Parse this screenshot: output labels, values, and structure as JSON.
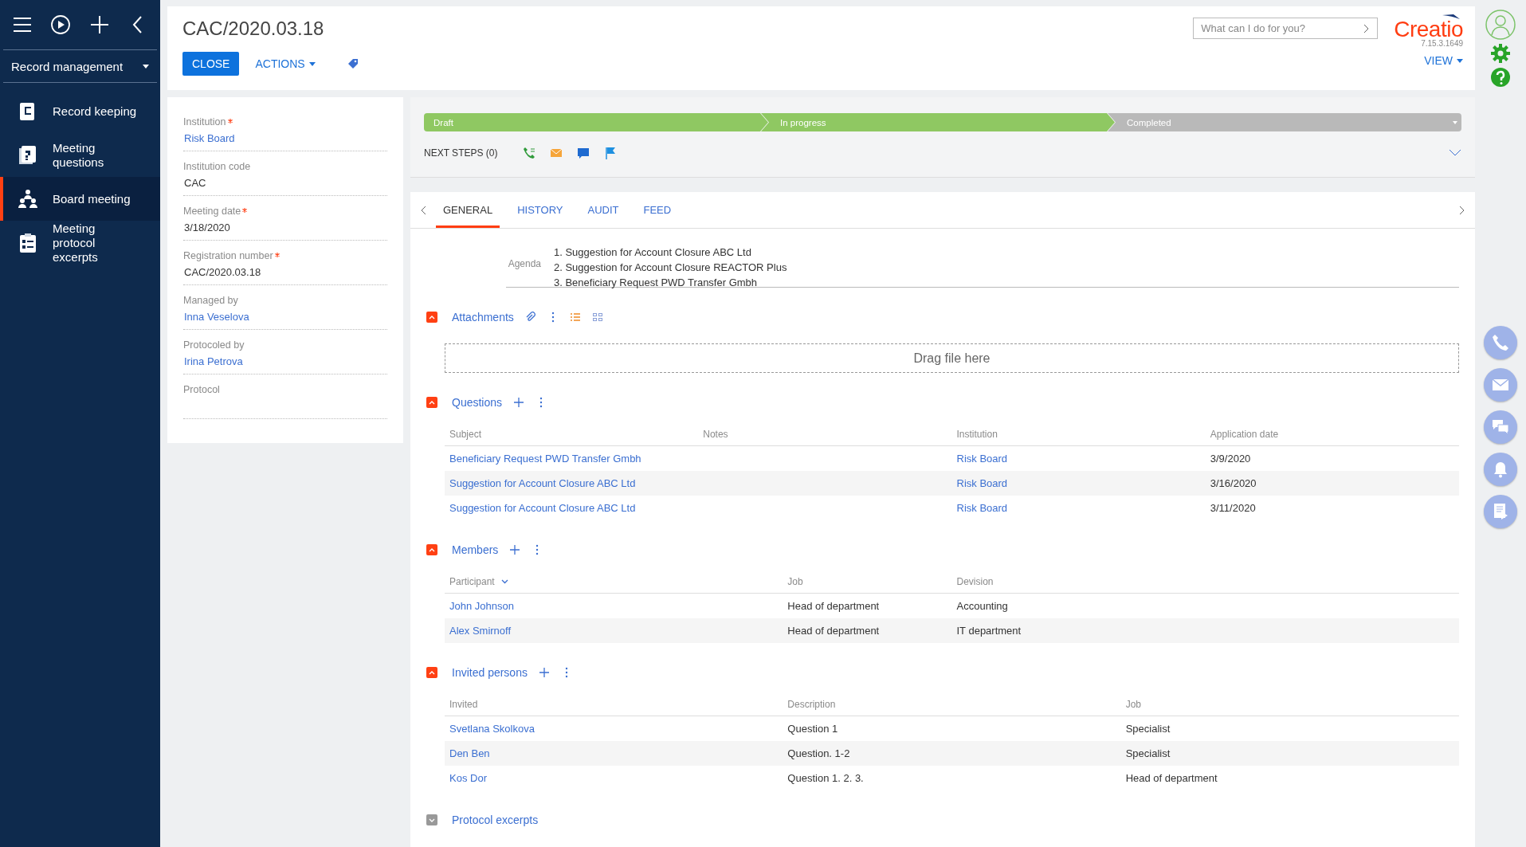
{
  "sidebar": {
    "workplace": "Record management",
    "items": [
      {
        "label": "Record keeping",
        "selected": false
      },
      {
        "label": "Meeting questions",
        "selected": false
      },
      {
        "label": "Board meeting",
        "selected": true
      },
      {
        "label": "Meeting protocol excerpts",
        "selected": false
      }
    ]
  },
  "header": {
    "title": "CAC/2020.03.18",
    "close": "CLOSE",
    "actions": "ACTIONS",
    "search": {
      "placeholder": "What can I do for you?"
    },
    "logo": "Creatio",
    "version": "7.15.3.1649",
    "view": "VIEW"
  },
  "fields": [
    {
      "label": "Institution",
      "required": true,
      "value": "Risk Board",
      "kind": "link"
    },
    {
      "label": "Institution code",
      "required": false,
      "value": "CAC",
      "kind": "text"
    },
    {
      "label": "Meeting date",
      "required": true,
      "value": "3/18/2020",
      "kind": "text"
    },
    {
      "label": "Registration number",
      "required": true,
      "value": "CAC/2020.03.18",
      "kind": "text"
    },
    {
      "label": "Managed by",
      "required": false,
      "value": "Inna Veselova",
      "kind": "link"
    },
    {
      "label": "Protocoled by",
      "required": false,
      "value": "Irina Petrova",
      "kind": "link"
    },
    {
      "label": "Protocol",
      "required": false
    }
  ],
  "stages": [
    {
      "label": "Draft",
      "done": true
    },
    {
      "label": "In progress",
      "done": true
    },
    {
      "label": "Completed",
      "done": false
    }
  ],
  "next_steps": "NEXT STEPS (0)",
  "tabs": [
    {
      "label": "GENERAL",
      "selected": true
    },
    {
      "label": "HISTORY",
      "selected": false
    },
    {
      "label": "AUDIT",
      "selected": false
    },
    {
      "label": "FEED",
      "selected": false
    }
  ],
  "agenda": {
    "label": "Agenda",
    "lines": [
      "1. Suggestion for Account Closure ABC Ltd",
      "2.  Suggestion for Account Closure REACTOR Plus",
      "3. Beneficiary Request PWD Transfer Gmbh"
    ]
  },
  "sections": [
    {
      "title": "Attachments",
      "kind": "files",
      "expanded": true,
      "drop_text": "Drag file here"
    },
    {
      "title": "Questions",
      "kind": "grid",
      "expanded": true,
      "columns": [
        {
          "label": "Subject",
          "kind": "link",
          "sorted": false
        },
        {
          "label": "Notes",
          "kind": "text",
          "sorted": false
        },
        {
          "label": "Institution",
          "kind": "link",
          "sorted": false
        },
        {
          "label": "Application date",
          "kind": "text",
          "sorted": false
        }
      ],
      "rows": [
        [
          "Beneficiary Request PWD Transfer Gmbh",
          "",
          "Risk Board",
          "3/9/2020"
        ],
        [
          "Suggestion for Account Closure ABC Ltd",
          "",
          "Risk Board",
          "3/16/2020"
        ],
        [
          "Suggestion for Account Closure ABC Ltd",
          "",
          "Risk Board",
          "3/11/2020"
        ]
      ]
    },
    {
      "title": "Members",
      "kind": "grid",
      "expanded": true,
      "columns": [
        {
          "label": "Participant",
          "kind": "link",
          "sorted": true
        },
        {
          "label": "Job",
          "kind": "text",
          "sorted": false
        },
        {
          "label": "Devision",
          "kind": "text",
          "sorted": false
        }
      ],
      "rows": [
        [
          "John Johnson",
          "Head of department",
          "Accounting"
        ],
        [
          "Alex Smirnoff",
          "Head of department",
          "IT department"
        ]
      ]
    },
    {
      "title": "Invited persons",
      "kind": "grid",
      "expanded": true,
      "columns": [
        {
          "label": "Invited",
          "kind": "link",
          "sorted": false
        },
        {
          "label": "Description",
          "kind": "text",
          "sorted": false
        },
        {
          "label": "Job",
          "kind": "text",
          "sorted": false
        }
      ],
      "rows": [
        [
          "Svetlana Skolkova",
          "Question 1",
          "Specialist"
        ],
        [
          "Den Ben",
          "Question. 1-2",
          "Specialist"
        ],
        [
          "Kos Dor",
          "Question 1. 2. 3.",
          "Head of department"
        ]
      ]
    },
    {
      "title": "Protocol excerpts",
      "kind": "grid",
      "expanded": false
    }
  ]
}
